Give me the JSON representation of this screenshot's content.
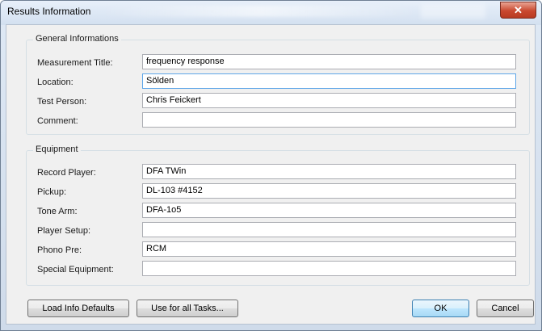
{
  "window": {
    "title": "Results Information",
    "close_label": "✕"
  },
  "general": {
    "title": "General Informations",
    "fields": [
      {
        "label": "Measurement Title:",
        "value": "frequency response"
      },
      {
        "label": "Location:",
        "value": "Sölden"
      },
      {
        "label": "Test Person:",
        "value": "Chris Feickert"
      },
      {
        "label": "Comment:",
        "value": ""
      }
    ]
  },
  "equipment": {
    "title": "Equipment",
    "fields": [
      {
        "label": "Record Player:",
        "value": "DFA TWin"
      },
      {
        "label": "Pickup:",
        "value": "DL-103 #4152"
      },
      {
        "label": "Tone Arm:",
        "value": "DFA-1o5"
      },
      {
        "label": "Player Setup:",
        "value": ""
      },
      {
        "label": "Phono Pre:",
        "value": "RCM"
      },
      {
        "label": "Special Equipment:",
        "value": ""
      }
    ]
  },
  "buttons": {
    "load_defaults": "Load Info Defaults",
    "use_all": "Use for all Tasks...",
    "ok": "OK",
    "cancel": "Cancel"
  }
}
